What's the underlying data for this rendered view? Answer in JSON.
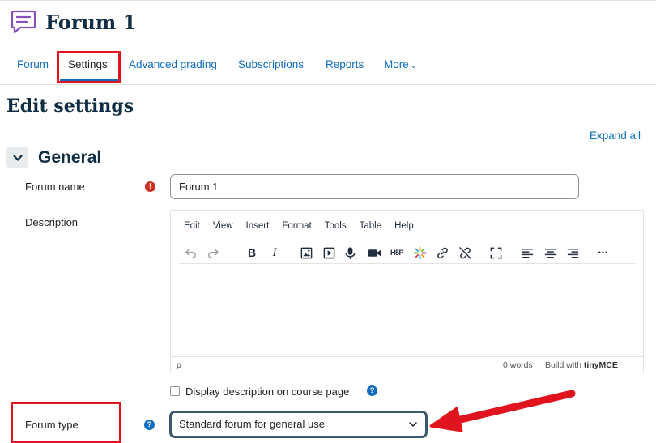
{
  "header": {
    "title": "Forum 1"
  },
  "nav": {
    "items": [
      {
        "label": "Forum"
      },
      {
        "label": "Settings"
      },
      {
        "label": "Advanced grading"
      },
      {
        "label": "Subscriptions"
      },
      {
        "label": "Reports"
      },
      {
        "label": "More"
      }
    ]
  },
  "page": {
    "title": "Edit settings",
    "expand_all": "Expand all",
    "section_title": "General"
  },
  "form": {
    "forum_name_label": "Forum name",
    "forum_name_value": "Forum 1",
    "description_label": "Description",
    "display_description_label": "Display description on course page",
    "forum_type_label": "Forum type",
    "forum_type_value": "Standard forum for general use",
    "required_icon": "!",
    "help_icon": "?"
  },
  "editor": {
    "menus": [
      "Edit",
      "View",
      "Insert",
      "Format",
      "Tools",
      "Table",
      "Help"
    ],
    "toolbar_icons": [
      "undo-icon",
      "redo-icon",
      "bold-icon",
      "italic-icon",
      "image-icon",
      "media-icon",
      "record-audio-icon",
      "record-video-icon",
      "h5p-icon",
      "multimedia-icon",
      "link-icon",
      "unlink-icon",
      "fullscreen-icon",
      "align-left-icon",
      "align-center-icon",
      "align-right-icon",
      "more-icon"
    ],
    "bold_glyph": "B",
    "italic_glyph": "I",
    "h5p_glyph": "H5P",
    "more_glyph": "•••",
    "status_path": "p",
    "word_count": "0 words",
    "built_with": "Build with",
    "brand": "tinyMCE"
  },
  "colors": {
    "link": "#0f6cbf",
    "heading": "#0f2d43",
    "highlight_box": "#e0141e",
    "required": "#ca3120"
  }
}
